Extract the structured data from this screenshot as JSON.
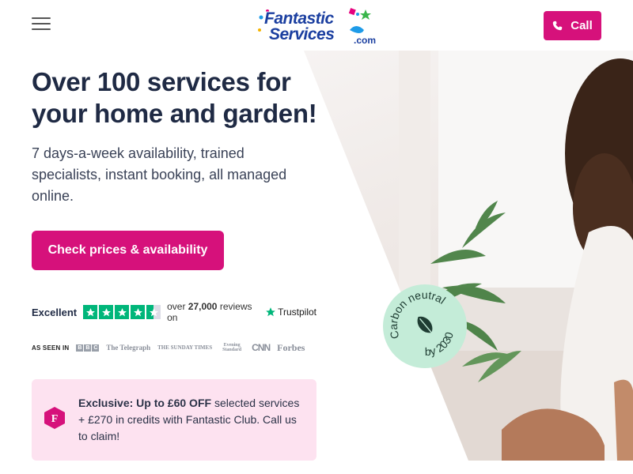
{
  "header": {
    "logo_line1": "Fantastic",
    "logo_line2": "Services",
    "logo_suffix": ".com",
    "call_label": "Call",
    "menu_icon": "hamburger-icon",
    "phone_icon": "phone-icon"
  },
  "hero": {
    "headline": "Over 100 services for your home and garden!",
    "subtext": "7 days-a-week availability, trained specialists, instant booking, all managed online.",
    "cta_label": "Check prices & availability"
  },
  "trustpilot": {
    "rating_word": "Excellent",
    "stars": 4.5,
    "reviews_prefix": "over",
    "reviews_count": "27,000",
    "reviews_suffix": "reviews on",
    "brand": "Trustpilot"
  },
  "press": {
    "label": "AS SEEN IN",
    "outlets": [
      "BBC",
      "The Telegraph",
      "THE SUNDAY TIMES",
      "Evening Standard",
      "CNN",
      "Forbes"
    ]
  },
  "promo": {
    "bold": "Exclusive: Up to £60 OFF",
    "rest": " selected services + £270 in credits with Fantastic Club. Call us to claim!",
    "icon": "fantastic-club-icon"
  },
  "badge": {
    "top_text": "Carbon neutral",
    "bottom_text": "by 2030",
    "icon": "leaf-icon"
  },
  "colors": {
    "brand_pink": "#d6117b",
    "brand_navy": "#1f2a44",
    "promo_bg": "#fde2f0",
    "badge_bg": "#c4ecd8",
    "trustpilot_green": "#00b67a"
  }
}
